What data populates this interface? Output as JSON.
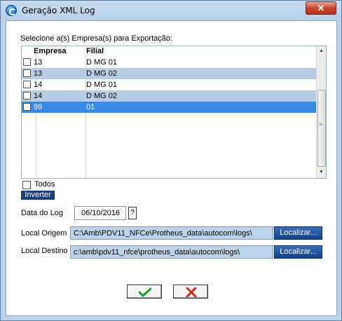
{
  "window": {
    "title": "Geração XML Log",
    "close_label": "✕",
    "icon": "protheus-app-icon"
  },
  "companies": {
    "label": "Selecione a(s) Empresa(s) para Exportação:",
    "columns": [
      "Empresa",
      "Filial"
    ],
    "rows": [
      {
        "empresa": "13",
        "filial": "D MG 01",
        "checked": false,
        "style": "normal"
      },
      {
        "empresa": "13",
        "filial": "D MG 02",
        "checked": false,
        "style": "alt"
      },
      {
        "empresa": "14",
        "filial": "D MG 01",
        "checked": false,
        "style": "normal"
      },
      {
        "empresa": "14",
        "filial": "D MG 02",
        "checked": false,
        "style": "alt"
      },
      {
        "empresa": "99",
        "filial": "01",
        "checked": false,
        "style": "selected"
      }
    ]
  },
  "todos": {
    "label": "Todos",
    "checked": false
  },
  "inverter": {
    "label": "Inverter"
  },
  "date_log": {
    "label": "Data do Log",
    "value": "06/10/2016",
    "help_label": "?"
  },
  "origem": {
    "label": "Local Origem",
    "value": "C:\\Amb\\PDV11_NFCe\\Protheus_data\\autocom\\logs\\",
    "button": "Localizar..."
  },
  "destino": {
    "label": "Local Destino",
    "value": "c:\\amb\\pdv11_nfce\\protheus_data\\autocom\\logs\\",
    "button": "Localizar..."
  },
  "actions": {
    "confirm_icon": "check-icon",
    "cancel_icon": "x-icon"
  },
  "colors": {
    "selected_row": "#3a89e6",
    "alt_row": "#b8cce4",
    "button_blue": "#1e3f74"
  }
}
